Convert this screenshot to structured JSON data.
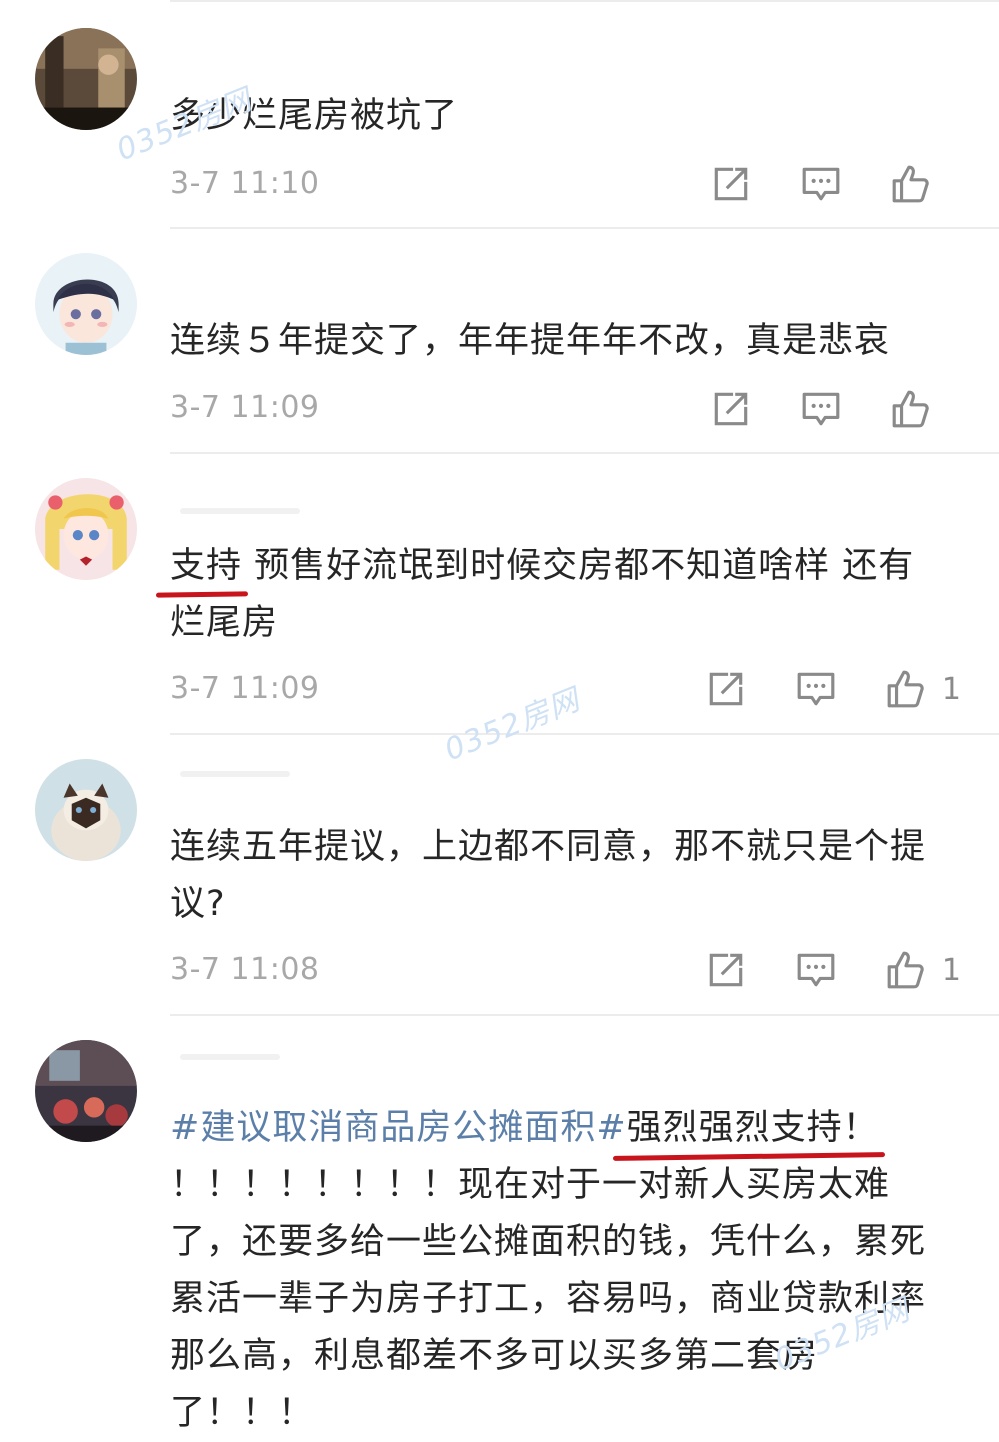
{
  "comments": [
    {
      "text": "多少烂尾房被坑了",
      "time": "3-7 11:10",
      "likes": ""
    },
    {
      "text": "连续５年提交了，年年提年年不改，真是悲哀",
      "time": "3-7 11:09",
      "likes": ""
    },
    {
      "text_part1": "支持",
      "text_part2": " 预售好流氓到时候交房都不知道啥样 还有烂尾房",
      "time": "3-7 11:09",
      "likes": "1"
    },
    {
      "text": "连续五年提议，上边都不同意，那不就只是个提议?",
      "time": "3-7 11:08",
      "likes": "1"
    },
    {
      "hashtag": "#建议取消商品房公摊面积#",
      "text_part1": "强烈强烈支持！",
      "text_part2": "！！！！！！！！现在对于一对新人买房太难了，还要多给一些公摊面积的钱，凭什么，累死累活一辈子为房子打工，容易吗，商业贷款利率那么高，利息都差不多可以买多第二套房了！！！"
    }
  ],
  "watermark": "0352房网",
  "icons": [
    "share-icon",
    "comment-icon",
    "like-icon"
  ],
  "colors": {
    "hashtag": "#5b7fa8",
    "underline": "#c8141c",
    "meta": "#a8a8a8"
  }
}
